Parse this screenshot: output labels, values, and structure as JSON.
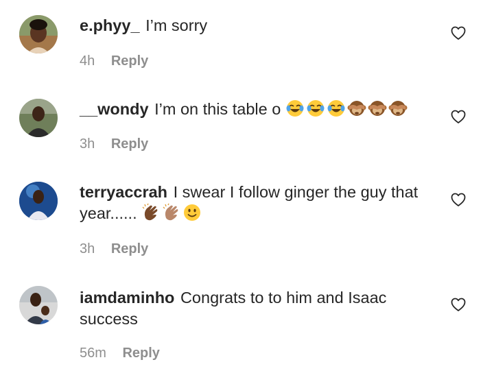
{
  "comments": [
    {
      "username": "e.phyy_",
      "text": "I’m sorry",
      "time": "4h",
      "reply_label": "Reply",
      "emojis": []
    },
    {
      "username": "__wondy",
      "text": "I’m on this table o",
      "time": "3h",
      "reply_label": "Reply",
      "emojis": [
        "tears-of-joy",
        "tears-of-joy",
        "tears-of-joy",
        "see-no-evil-monkey",
        "see-no-evil-monkey",
        "see-no-evil-monkey"
      ]
    },
    {
      "username": "terryaccrah",
      "text": "I swear I follow ginger the guy that year......",
      "time": "3h",
      "reply_label": "Reply",
      "emojis": [
        "clapping-hands-dark",
        "clapping-hands-medium",
        "slightly-smiling-face"
      ]
    },
    {
      "username": "iamdaminho",
      "text": "Congrats to to him and Isaac success",
      "time": "56m",
      "reply_label": "Reply",
      "emojis": []
    }
  ],
  "colors": {
    "text": "#262626",
    "meta": "#8e8e8e",
    "background": "#ffffff"
  }
}
